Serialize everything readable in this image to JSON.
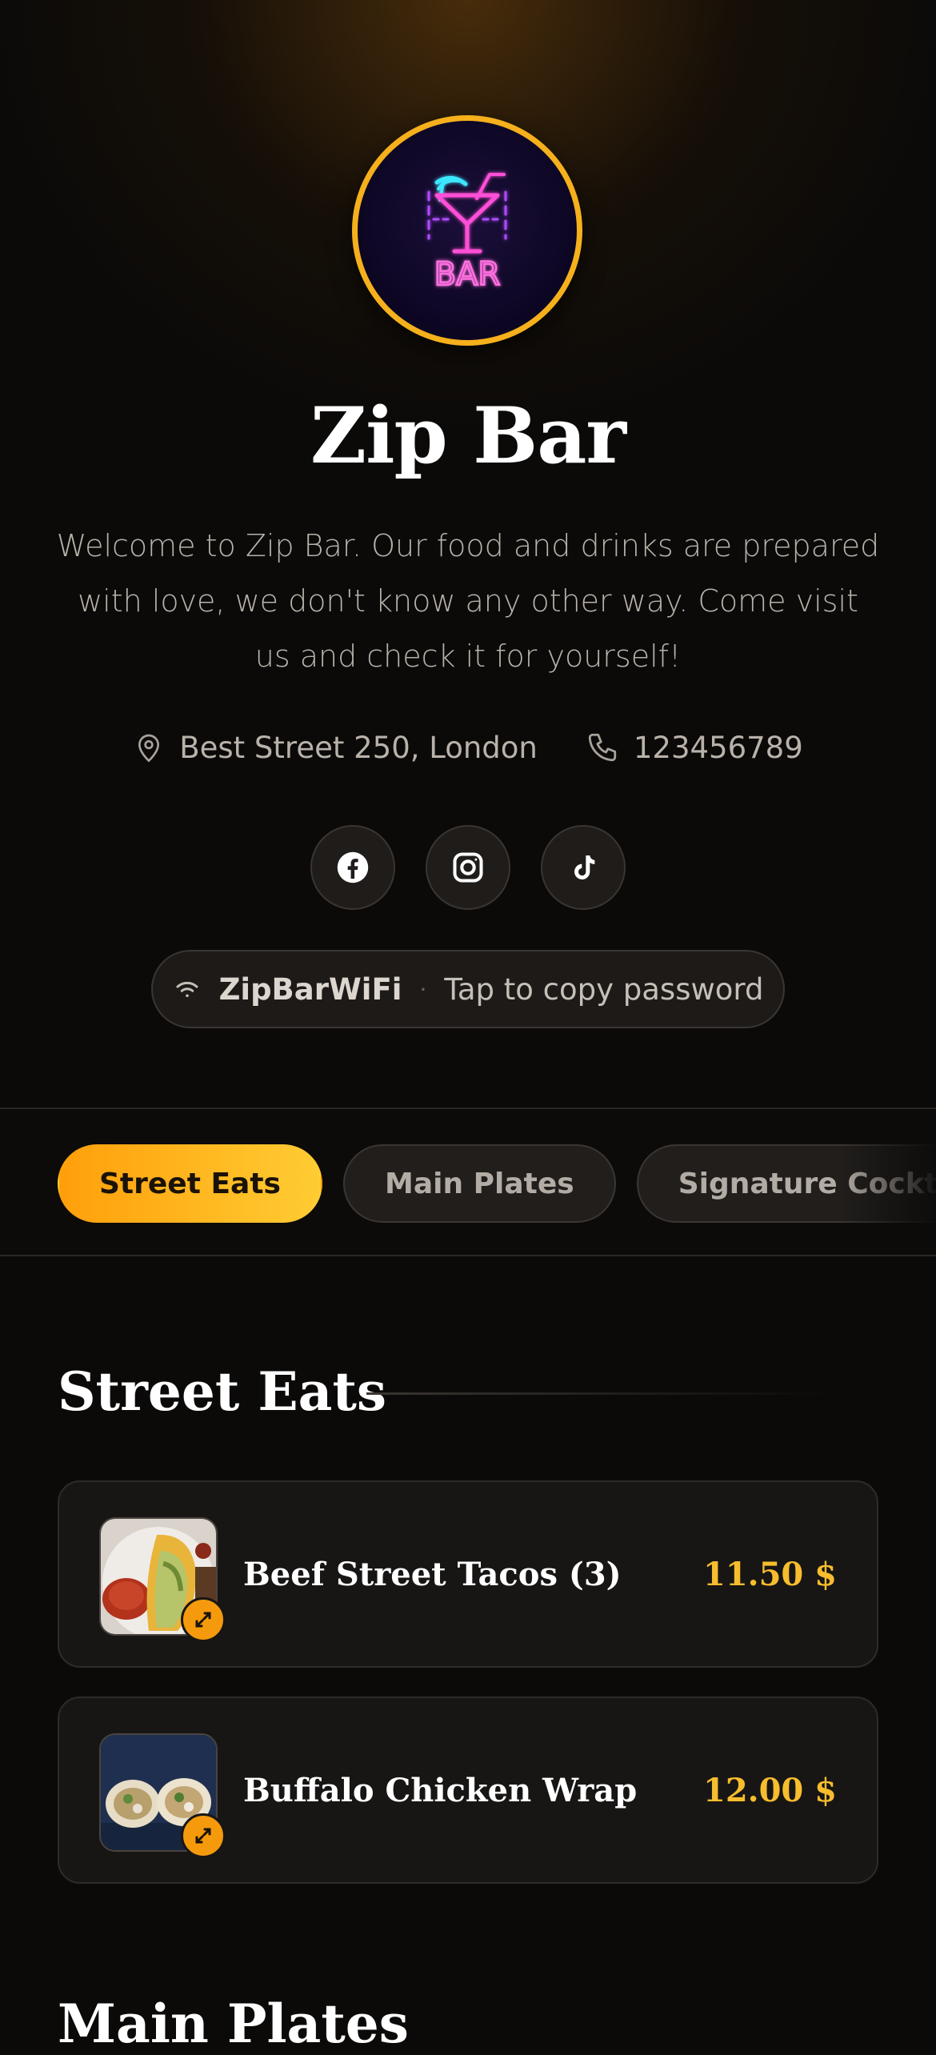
{
  "venue": {
    "name": "Zip Bar",
    "description": "Welcome to Zip Bar. Our food and drinks are prepared with love, we don't know any other way. Come visit us and check it for yourself!",
    "logo_text": "BAR",
    "address": "Best Street 250, London",
    "phone": "123456789"
  },
  "socials": [
    {
      "name": "facebook-icon"
    },
    {
      "name": "instagram-icon"
    },
    {
      "name": "tiktok-icon"
    }
  ],
  "wifi": {
    "name": "ZipBarWiFi",
    "separator": "·",
    "action": "Tap to copy password"
  },
  "tabs": [
    {
      "label": "Street Eats",
      "active": true
    },
    {
      "label": "Main Plates",
      "active": false
    },
    {
      "label": "Signature Cocktails",
      "active": false
    }
  ],
  "sections": [
    {
      "title": "Street Eats",
      "items": [
        {
          "name": "Beef Street Tacos (3)",
          "price": "11.50 $"
        },
        {
          "name": "Buffalo Chicken Wrap",
          "price": "12.00 $"
        }
      ]
    },
    {
      "title": "Main Plates"
    }
  ],
  "colors": {
    "accent": "#f5b01c",
    "price": "#f7bd2d",
    "background": "#0b0a09"
  }
}
